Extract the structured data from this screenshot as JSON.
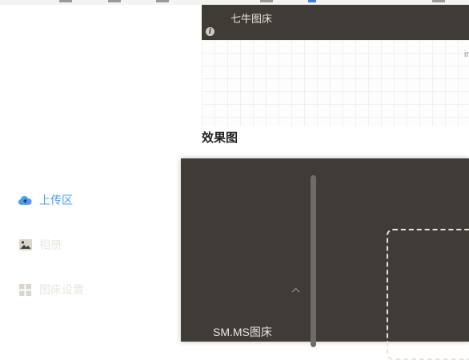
{
  "header": {
    "title": "七牛图床",
    "info_icon": "info-icon"
  },
  "grid": {
    "edge_text": "ir"
  },
  "section": {
    "title": "效果图"
  },
  "sidebar": {
    "items": [
      {
        "label": "上传区",
        "icon": "cloud-upload-icon",
        "active": true
      },
      {
        "label": "相册",
        "icon": "image-icon",
        "active": false
      },
      {
        "label": "图床设置",
        "icon": "grid-icon",
        "active": false,
        "expanded": true
      }
    ],
    "sub_items": [
      {
        "label": "SM.MS图床"
      }
    ]
  },
  "colors": {
    "accent": "#4a9ff5",
    "dark_bg": "#3f3c38",
    "text_light": "#e9e6df"
  }
}
